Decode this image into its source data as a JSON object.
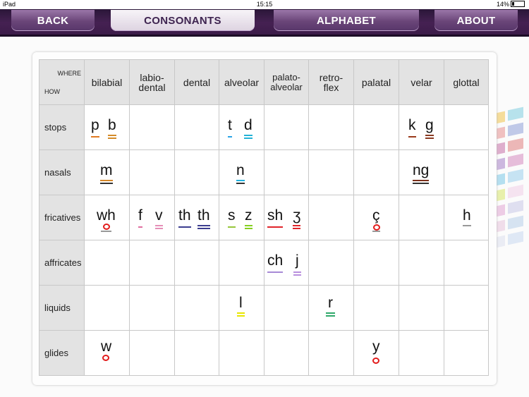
{
  "status": {
    "device": "iPad",
    "time": "15:15",
    "battery": "14%"
  },
  "nav": {
    "back": "BACK",
    "consonants": "CONSONANTS",
    "alphabet": "ALPHABET",
    "about": "ABOUT"
  },
  "table": {
    "corner_where": "WHERE",
    "corner_how": "HOW",
    "columns": [
      "bilabial",
      "labio-dental",
      "dental",
      "alveolar",
      "palato-alveolar",
      "retro-flex",
      "palatal",
      "velar",
      "glottal"
    ],
    "rows": [
      "stops",
      "nasals",
      "fricatives",
      "affricates",
      "liquids",
      "glides"
    ]
  },
  "symbols": {
    "p": "p",
    "b": "b",
    "t": "t",
    "d": "d",
    "k": "k",
    "g": "g",
    "m": "m",
    "n": "n",
    "ng": "ng",
    "wh": "wh",
    "f": "f",
    "v": "v",
    "th1": "th",
    "th2": "th",
    "s": "s",
    "z": "z",
    "sh": "sh",
    "zh": "ʒ",
    "c": "ç",
    "h": "h",
    "ch": "ch",
    "j": "j",
    "l": "l",
    "r": "r",
    "w": "w",
    "y": "y"
  },
  "colors": {
    "p": "#e07a22",
    "b": "#d48b28",
    "t": "#2aa3e6",
    "d": "#23b2d6",
    "k": "#9a3b1c",
    "g": "#8a3a22",
    "m": "#d38527",
    "n": "#1fb0de",
    "ng": "#7a2f1a",
    "wh": "#7a7a7a",
    "f": "#e06fa0",
    "v": "#e58fb8",
    "th": "#3c3e8f",
    "s": "#96c63a",
    "z": "#86d020",
    "sh": "#e0242a",
    "zh": "#e0242a",
    "c": "#999999",
    "ch": "#a78ad6",
    "j": "#b98fde",
    "l": "#e8e600",
    "r": "#2ea86a",
    "accent": "#452152"
  }
}
